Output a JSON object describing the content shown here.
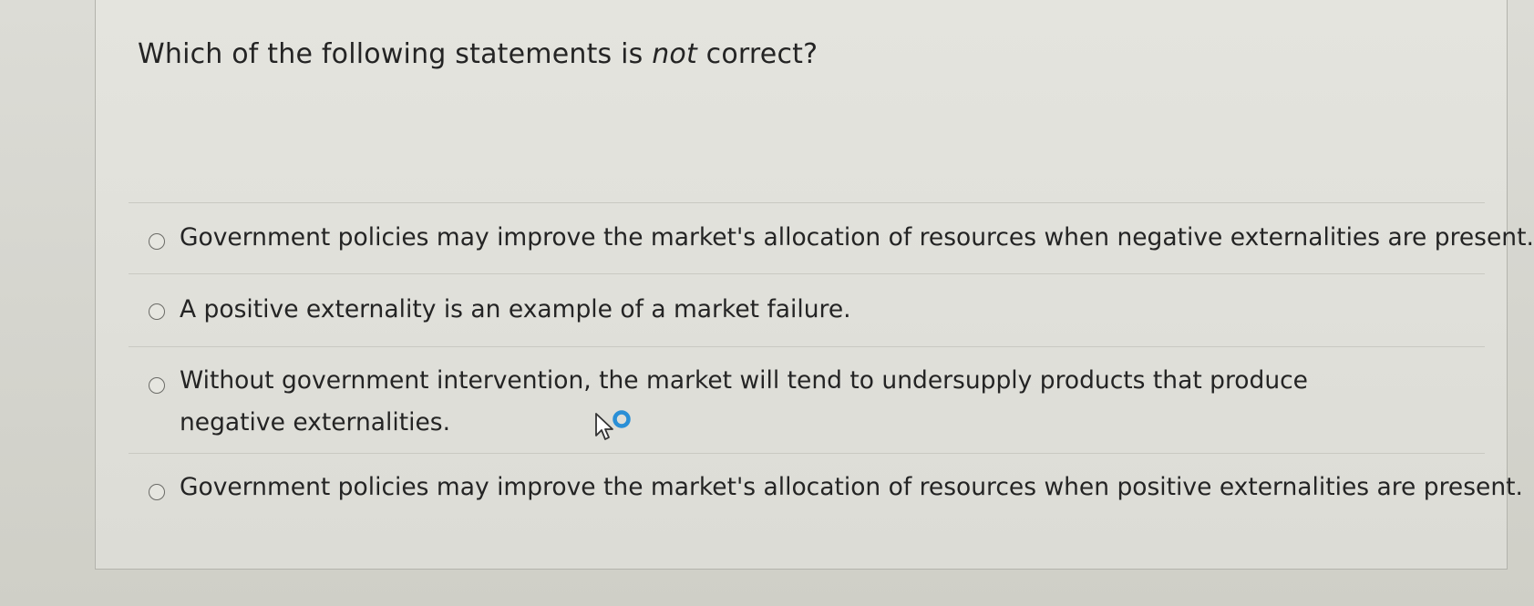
{
  "question": {
    "prefix": "Which of the following statements is ",
    "emphasis": "not",
    "suffix": " correct?"
  },
  "answers": [
    {
      "label": "Government policies may improve the market's allocation of resources when negative externalities are present.",
      "selected": false
    },
    {
      "label": "A positive externality is an example of a market failure.",
      "selected": false
    },
    {
      "label": "Without government intervention, the market will tend to undersupply products that produce negative externalities.",
      "selected": false
    },
    {
      "label": "Government policies may improve the market's allocation of resources when positive externalities are present.",
      "selected": false
    }
  ],
  "cursor": {
    "icon": "mouse-pointer-busy-icon",
    "accent": "#2a8fd6"
  }
}
